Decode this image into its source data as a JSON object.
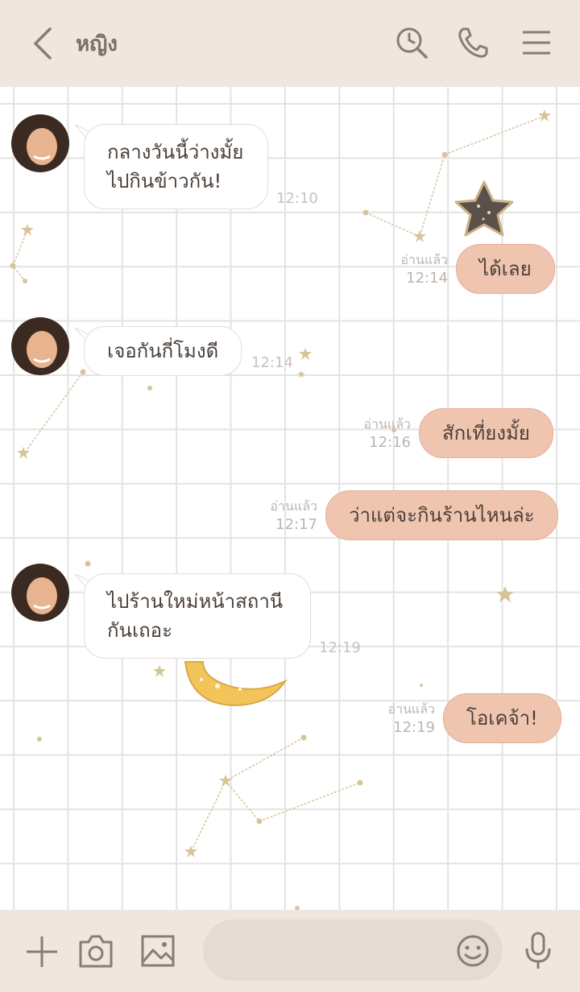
{
  "header": {
    "contact_name": "หญิง"
  },
  "messages": [
    {
      "direction": "in",
      "text": "กลางวันนี้ว่างมั้ย\nไปกินข้าวกัน!",
      "time": "12:10"
    },
    {
      "direction": "out",
      "text": "ได้เลย",
      "read": "อ่านแล้ว",
      "time": "12:14"
    },
    {
      "direction": "in",
      "text": "เจอกันกี่โมงดี",
      "time": "12:14"
    },
    {
      "direction": "out",
      "text": "สักเที่ยงมั้ย",
      "read": "อ่านแล้ว",
      "time": "12:16"
    },
    {
      "direction": "out",
      "text": "ว่าแต่จะกินร้านไหนล่ะ",
      "read": "อ่านแล้ว",
      "time": "12:17"
    },
    {
      "direction": "in",
      "text": "ไปร้านใหม่หน้าสถานี\nกันเถอะ",
      "time": "12:19"
    },
    {
      "direction": "out",
      "text": "โอเคจ้า!",
      "read": "อ่านแล้ว",
      "time": "12:19"
    }
  ],
  "icons": {
    "header": [
      "chevron-left-icon",
      "search-history-icon",
      "phone-icon",
      "menu-icon"
    ],
    "footer": [
      "plus-icon",
      "camera-icon",
      "image-icon",
      "emoji-icon",
      "microphone-icon"
    ]
  },
  "colors": {
    "bar": "#efe6df",
    "outgoing_bubble": "#f0c5b0",
    "incoming_bubble": "#ffffff",
    "input": "#e6dbd3"
  }
}
